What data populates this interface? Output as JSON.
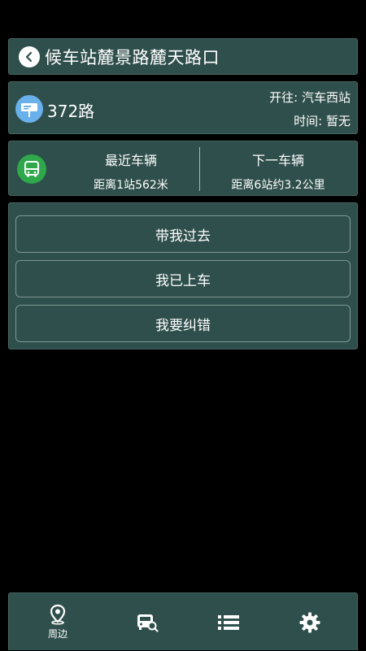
{
  "header": {
    "title": "候车站麓景路麓天路口",
    "back_icon": "chevron-left-icon"
  },
  "route": {
    "number": "372路",
    "destination": "开往: 汽车西站",
    "time": "时间: 暂无",
    "icon": "bus-stop-sign-icon",
    "icon_color": "#6ab0ea"
  },
  "vehicles": {
    "icon": "bus-icon",
    "icon_color": "#2ea84b",
    "nearest": {
      "title": "最近车辆",
      "distance": "距离1站562米"
    },
    "next": {
      "title": "下一车辆",
      "distance": "距离6站约3.2公里"
    }
  },
  "actions": {
    "take_me_label": "带我过去",
    "boarded_label": "我已上车",
    "report_error_label": "我要纠错"
  },
  "bottom_nav": {
    "nearby_label": "周边",
    "items": [
      "map-pin-icon",
      "bus-search-icon",
      "list-icon",
      "gear-icon"
    ]
  },
  "colors": {
    "panel": "#2f4f4c",
    "background": "#000000",
    "text": "#ffffff"
  }
}
